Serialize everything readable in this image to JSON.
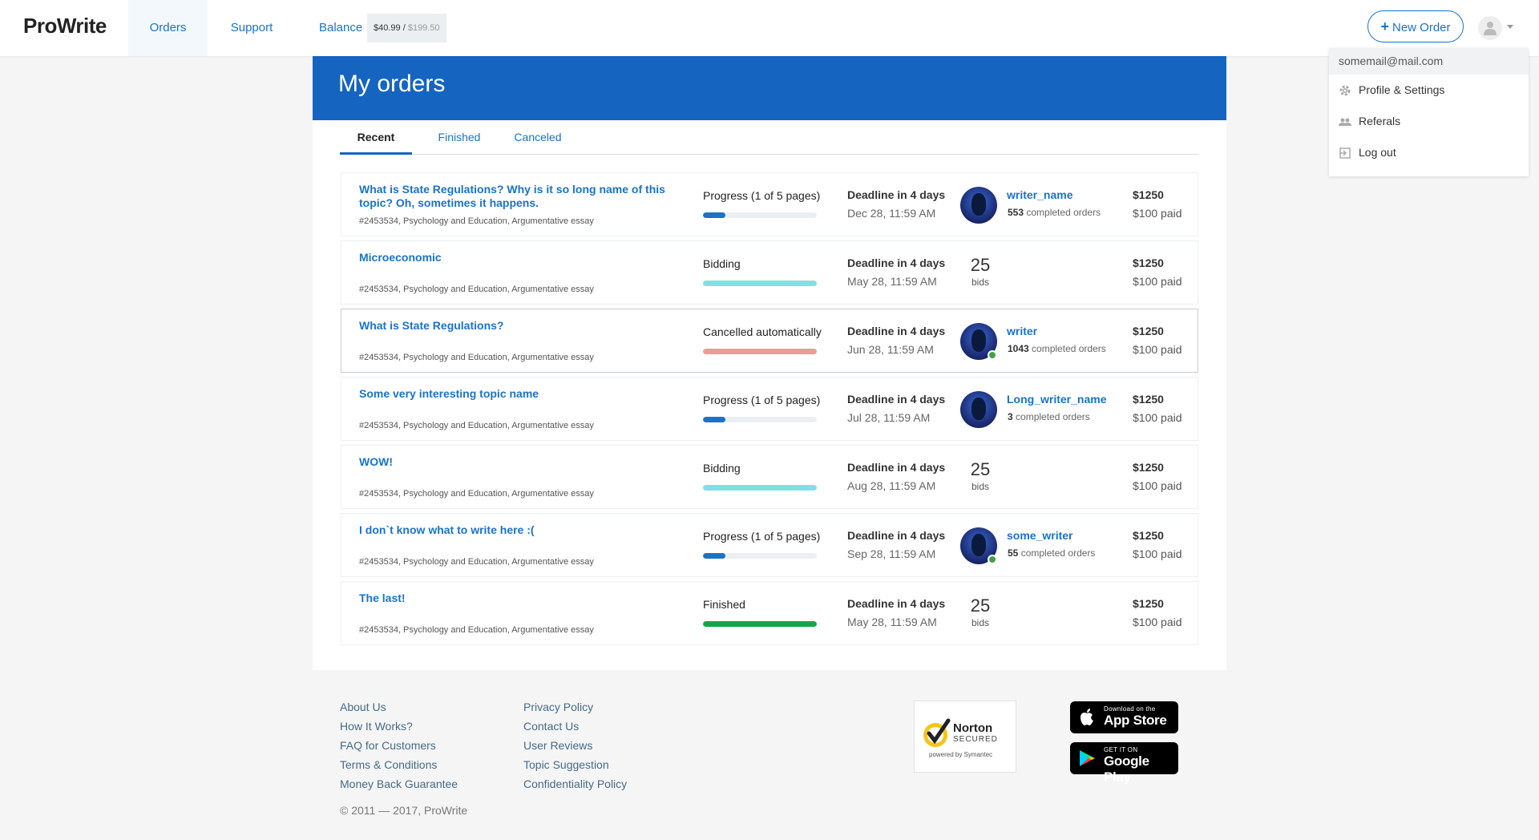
{
  "header": {
    "logo": "ProWrite",
    "nav": {
      "orders": "Orders",
      "support": "Support",
      "balance": "Balance"
    },
    "balance": {
      "current": "$40.99",
      "separator": " / ",
      "total": "$199.50"
    },
    "new_order": "New Order"
  },
  "account_menu": {
    "email": "somemail@mail.com",
    "items": [
      {
        "label": "Profile & Settings",
        "icon": "gear-icon"
      },
      {
        "label": "Referals",
        "icon": "people-icon"
      },
      {
        "label": "Log out",
        "icon": "logout-icon"
      }
    ]
  },
  "page": {
    "title": "My orders",
    "tabs": [
      {
        "label": "Recent",
        "active": true
      },
      {
        "label": "Finished",
        "active": false
      },
      {
        "label": "Canceled",
        "active": false
      }
    ]
  },
  "orders": [
    {
      "title": "What is State Regulations? Why is it so long name of this topic? Oh, sometimes it happens.",
      "meta": "#2453534, Psychology and Education, Argumentative essay",
      "status": "Progress (1 of 5 pages)",
      "progress": 0.2,
      "bar_color": "#1a73c8",
      "deadline": "Deadline in 4 days",
      "date": "Dec 28, 11:59 AM",
      "writer": "writer_name",
      "completed_count": "553",
      "completed_label": "completed orders",
      "online": false,
      "price": "$1250",
      "paid": "$100 paid"
    },
    {
      "title": "Microeconomic",
      "meta": "#2453534, Psychology and Education, Argumentative essay",
      "status": "Bidding",
      "progress": 1.0,
      "bar_color": "#80deea",
      "deadline": "Deadline in 4 days",
      "date": "May 28, 11:59 AM",
      "bids": "25",
      "bids_label": "bids",
      "price": "$1250",
      "paid": "$100 paid"
    },
    {
      "title": "What is State Regulations?",
      "meta": "#2453534, Psychology and Education, Argumentative essay",
      "status": "Cancelled automatically",
      "progress": 1.0,
      "bar_color": "#ef9a9a",
      "deadline": "Deadline in 4 days",
      "date": "Jun 28, 11:59 AM",
      "writer": "writer",
      "completed_count": "1043",
      "completed_label": "completed orders",
      "online": true,
      "price": "$1250",
      "paid": "$100 paid"
    },
    {
      "title": "Some very interesting topic name",
      "meta": "#2453534, Psychology and Education, Argumentative essay",
      "status": "Progress (1 of 5 pages)",
      "progress": 0.2,
      "bar_color": "#1a73c8",
      "deadline": "Deadline in 4 days",
      "date": "Jul 28, 11:59 AM",
      "writer": "Long_writer_name",
      "completed_count": "3",
      "completed_label": "completed orders",
      "online": false,
      "price": "$1250",
      "paid": "$100 paid"
    },
    {
      "title": "WOW!",
      "meta": "#2453534, Psychology and Education, Argumentative essay",
      "status": "Bidding",
      "progress": 1.0,
      "bar_color": "#80deea",
      "deadline": "Deadline in 4 days",
      "date": "Aug 28, 11:59 AM",
      "bids": "25",
      "bids_label": "bids",
      "price": "$1250",
      "paid": "$100 paid"
    },
    {
      "title": "I don`t know what to write here :(",
      "meta": "#2453534, Psychology and Education, Argumentative essay",
      "status": "Progress (1 of 5 pages)",
      "progress": 0.2,
      "bar_color": "#1a73c8",
      "deadline": "Deadline in 4 days",
      "date": "Sep 28, 11:59 AM",
      "writer": "some_writer",
      "completed_count": "55",
      "completed_label": "completed orders",
      "online": true,
      "price": "$1250",
      "paid": "$100 paid"
    },
    {
      "title": "The last!",
      "meta": "#2453534, Psychology and Education, Argumentative essay",
      "status": "Finished",
      "progress": 1.0,
      "bar_color": "#16a34a",
      "deadline": "Deadline in 4 days",
      "date": "May 28, 11:59 AM",
      "bids": "25",
      "bids_label": "bids",
      "price": "$1250",
      "paid": "$100 paid"
    }
  ],
  "footer": {
    "col1": [
      "About Us",
      "How It Works?",
      "FAQ for Customers",
      "Terms & Conditions",
      "Money Back Guarantee"
    ],
    "col2": [
      "Privacy Policy",
      "Contact Us",
      "User Reviews",
      "Topic Suggestion",
      "Confidentiality Policy"
    ],
    "copyright": "© 2011 — 2017, ProWrite",
    "norton": {
      "brand": "Norton",
      "secured": "SECURED",
      "powered": "powered by Symantec"
    },
    "app_store": {
      "small": "Download on the",
      "big": "App Store"
    },
    "google_play": {
      "small": "GET IT ON",
      "big": "Google Play"
    }
  }
}
